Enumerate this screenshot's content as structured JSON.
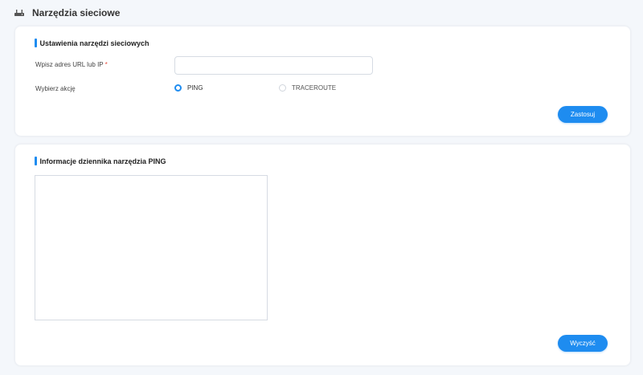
{
  "header": {
    "title": "Narzędzia sieciowe",
    "icon": "router-icon"
  },
  "settings": {
    "title": "Ustawienia narzędzi sieciowych",
    "url_label": "Wpisz adres URL lub IP",
    "required_mark": "*",
    "url_value": "",
    "url_placeholder": "",
    "action_label": "Wybierz akcję",
    "options": [
      {
        "label": "PING",
        "selected": true
      },
      {
        "label": "TRACEROUTE",
        "selected": false
      }
    ],
    "apply_label": "Zastosuj"
  },
  "log": {
    "title": "Informacje dziennika narzędzia PING",
    "content": "",
    "clear_label": "Wyczyść"
  },
  "colors": {
    "accent": "#1e8cf0",
    "background": "#f4f7fb",
    "card": "#ffffff",
    "required": "#e74c3c"
  }
}
